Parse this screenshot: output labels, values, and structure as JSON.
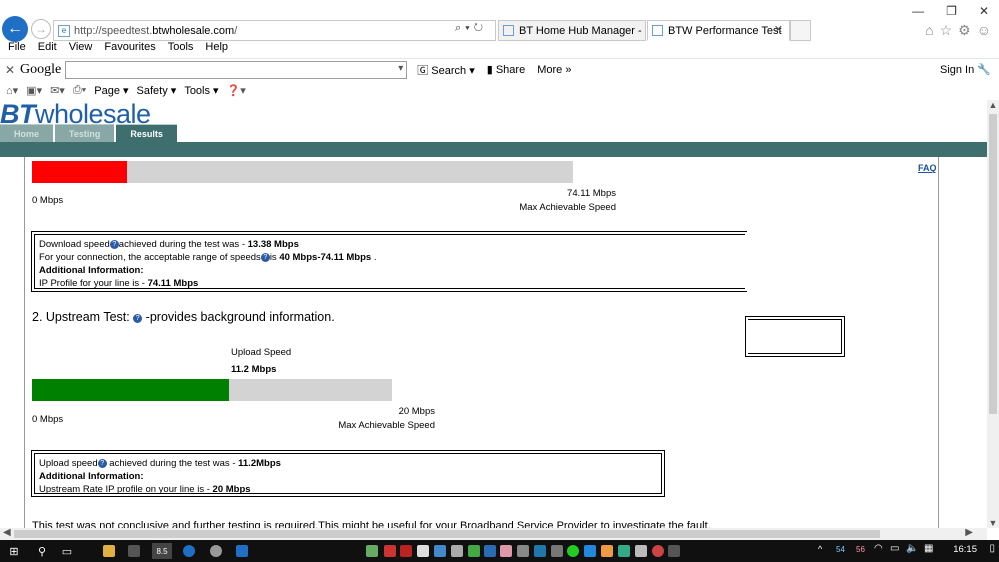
{
  "browser": {
    "address": {
      "scheme": "http://speedtest.",
      "host": "btwholesale.com",
      "path": "/"
    },
    "tabs": [
      {
        "label": "BT Home Hub Manager - DHC..."
      },
      {
        "label": "BTW Performance Test"
      }
    ],
    "menu": [
      "File",
      "Edit",
      "View",
      "Favourites",
      "Tools",
      "Help"
    ],
    "google_toolbar": {
      "logo": "Google",
      "search": "Search",
      "share": "Share",
      "more": "More",
      "signin": "Sign In"
    },
    "command_bar": {
      "page": "Page",
      "safety": "Safety",
      "tools": "Tools"
    }
  },
  "site": {
    "logo_bt": "BT",
    "logo_rest": "wholesale",
    "nav_tabs": [
      {
        "label": "Home",
        "active": false
      },
      {
        "label": "Testing",
        "active": false
      },
      {
        "label": "Results",
        "active": true
      }
    ],
    "faq": "FAQ"
  },
  "download": {
    "value_mbps": 13.38,
    "max_mbps": 74.11,
    "zero_label": "0 Mbps",
    "max_label": "74.11 Mbps",
    "max_caption": "Max Achievable Speed",
    "info": {
      "line1_prefix": "Download speed",
      "line1_mid": "achieved during the test was - ",
      "line1_value": "13.38 Mbps",
      "line2_prefix": "For your connection, the acceptable range of speeds",
      "line2_mid": "is ",
      "line2_value": "40 Mbps-74.11 Mbps",
      "line2_suffix": " .",
      "additional": "Additional Information:",
      "line3_prefix": "IP Profile for your line is - ",
      "line3_value": "74.11 Mbps"
    }
  },
  "upload": {
    "section_title_prefix": "2. Upstream Test: ",
    "section_title_suffix": " -provides background information.",
    "caption": "Upload Speed",
    "value_label": "11.2 Mbps",
    "value_mbps": 11.2,
    "max_mbps": 20,
    "zero_label": "0 Mbps",
    "max_label": "20 Mbps",
    "max_caption": "Max Achievable Speed",
    "info": {
      "line1_prefix": "Upload speed",
      "line1_mid": " achieved during the test was - ",
      "line1_value": "11.2Mbps",
      "additional": "Additional Information:",
      "line2_prefix": "Upstream Rate IP profile on your line is - ",
      "line2_value": "20 Mbps"
    }
  },
  "footer_text": "This test was not conclusive and further testing is required.This might be useful for your Broadband Service Provider to investigate the fault.",
  "taskbar": {
    "clock": "16:15",
    "tray_a": "54",
    "tray_b": "56",
    "badge": "8.5"
  },
  "colors": {
    "download_fill": "#ff0000",
    "upload_fill": "#008000",
    "bar_track": "#d3d3d3",
    "bt_blue": "#1f5fa8",
    "nav_green": "#3e6e6e"
  }
}
